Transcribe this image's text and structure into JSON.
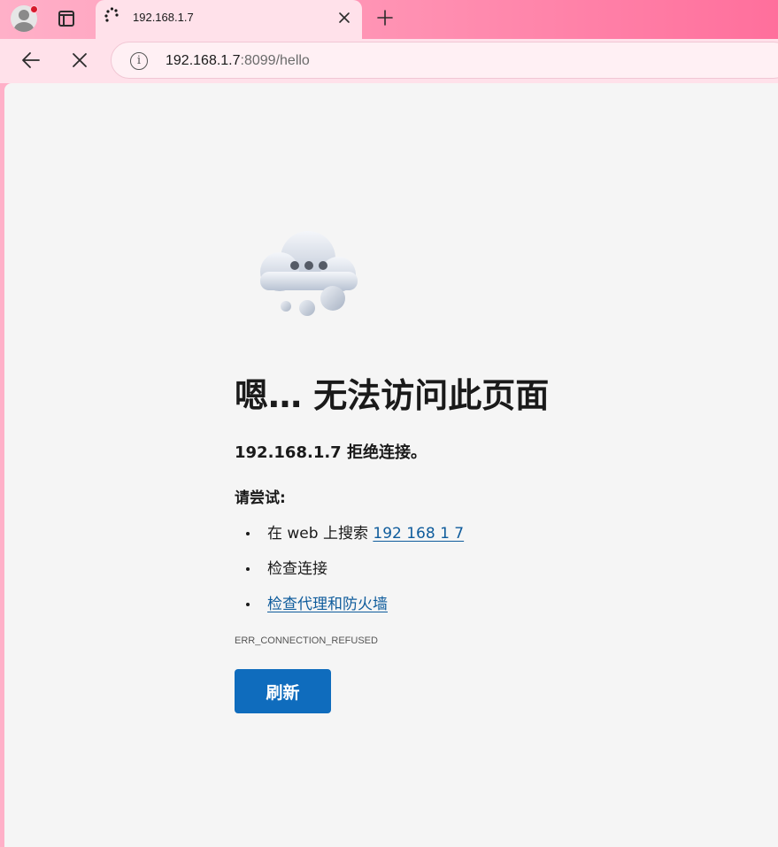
{
  "tab": {
    "title": "192.168.1.7"
  },
  "address_bar": {
    "host": "192.168.1.7",
    "rest": ":8099/hello"
  },
  "error_page": {
    "headline": "嗯… 无法访问此页面",
    "subhead": "192.168.1.7 拒绝连接。",
    "try_label": "请尝试:",
    "suggestions": {
      "search_prefix": "在 web 上搜索 ",
      "search_link": "192 168 1 7",
      "check_connection": "检查连接",
      "check_proxy": "检查代理和防火墙"
    },
    "error_code": "ERR_CONNECTION_REFUSED",
    "refresh_button": "刷新"
  },
  "colors": {
    "accent": "#0f6cbd",
    "link": "#0f5c9c",
    "tab_background": "#ffe1ea",
    "page_background": "#f5f5f5"
  },
  "icons": {
    "profile": "avatar-icon",
    "tab_actions": "tab-actions-icon",
    "loading": "loading-spinner-icon",
    "close_tab": "close-icon",
    "new_tab": "plus-icon",
    "back": "arrow-left-icon",
    "stop": "stop-x-icon",
    "site_info": "info-icon",
    "illustration": "cloud-offline-icon"
  }
}
